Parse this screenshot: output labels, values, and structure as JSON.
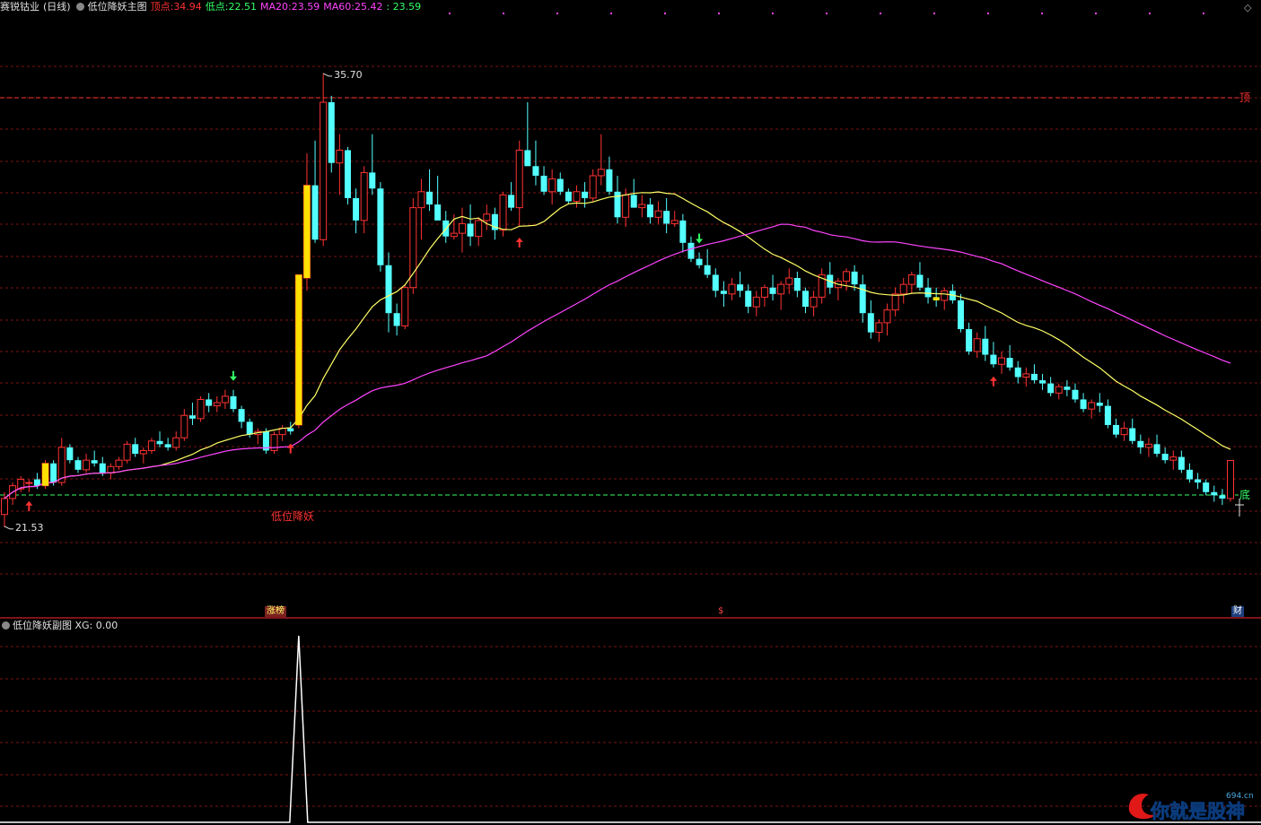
{
  "header": {
    "stock_name": "赛锐钴业",
    "period": "(日线)",
    "indicator_name": "低位降妖主图",
    "top_label": "顶点:",
    "top_value": "34.94",
    "low_label": "低点:",
    "low_value": "22.51",
    "ma20_label": "MA20:",
    "ma20_value": "23.59",
    "ma60_label": "MA60:",
    "ma60_value": "25.42",
    "last_value": ": 23.59"
  },
  "annotations": {
    "high_label": "35.70",
    "low_label": "21.53",
    "top_line_label": "顶",
    "bottom_line_label": "底",
    "signal_text": "低位降妖",
    "event_zhangting": "涨榜",
    "event_dollar": "$",
    "event_cai": "财"
  },
  "sub_header": {
    "indicator_name": "低位降妖副图",
    "xg_label": "XG:",
    "xg_value": "0.00"
  },
  "watermark": {
    "text": "你就是股神",
    "domain": "694.cn"
  },
  "colors": {
    "up": "#ff3232",
    "down": "#54ffff",
    "ma20": "#ffff66",
    "ma60": "#ff44ff",
    "grid": "#7a1414",
    "signal_bar": "#ffe000"
  },
  "chart_data": {
    "type": "candlestick",
    "top_price": 34.94,
    "bottom_price": 22.51,
    "high_mark": 35.7,
    "low_mark": 21.53,
    "candles": [
      [
        21.9,
        22.6,
        21.5,
        22.4
      ],
      [
        22.4,
        22.9,
        22.2,
        22.8
      ],
      [
        22.7,
        23.1,
        22.6,
        23.0
      ],
      [
        22.9,
        23.0,
        22.6,
        22.9
      ],
      [
        23.0,
        23.2,
        22.7,
        22.8
      ],
      [
        22.8,
        23.6,
        22.7,
        23.5
      ],
      [
        23.5,
        23.6,
        22.8,
        22.9
      ],
      [
        22.9,
        24.3,
        22.8,
        24.0
      ],
      [
        24.0,
        24.1,
        23.5,
        23.6
      ],
      [
        23.6,
        23.7,
        23.2,
        23.3
      ],
      [
        23.3,
        23.8,
        23.2,
        23.6
      ],
      [
        23.6,
        23.9,
        23.4,
        23.5
      ],
      [
        23.5,
        23.7,
        23.1,
        23.2
      ],
      [
        23.2,
        23.5,
        23.0,
        23.4
      ],
      [
        23.4,
        23.7,
        23.3,
        23.6
      ],
      [
        23.6,
        24.2,
        23.5,
        24.1
      ],
      [
        24.1,
        24.3,
        23.7,
        23.8
      ],
      [
        23.8,
        24.0,
        23.5,
        23.9
      ],
      [
        23.9,
        24.3,
        23.8,
        24.2
      ],
      [
        24.2,
        24.5,
        24.0,
        24.1
      ],
      [
        24.1,
        24.3,
        23.9,
        24.0
      ],
      [
        24.0,
        24.5,
        23.9,
        24.3
      ],
      [
        24.3,
        25.2,
        24.2,
        25.0
      ],
      [
        25.0,
        25.4,
        24.7,
        24.9
      ],
      [
        24.9,
        25.6,
        24.8,
        25.5
      ],
      [
        25.5,
        25.7,
        25.1,
        25.3
      ],
      [
        25.3,
        25.6,
        25.1,
        25.4
      ],
      [
        25.4,
        25.8,
        25.2,
        25.6
      ],
      [
        25.6,
        25.8,
        25.1,
        25.2
      ],
      [
        25.2,
        25.3,
        24.6,
        24.8
      ],
      [
        24.8,
        24.9,
        24.3,
        24.4
      ],
      [
        24.4,
        24.6,
        24.1,
        24.5
      ],
      [
        24.5,
        24.6,
        23.8,
        23.9
      ],
      [
        23.9,
        24.5,
        23.8,
        24.4
      ],
      [
        24.4,
        24.7,
        24.2,
        24.6
      ],
      [
        24.6,
        24.8,
        24.4,
        24.5
      ],
      [
        24.7,
        29.4,
        24.6,
        29.4
      ],
      [
        29.3,
        33.2,
        28.9,
        32.2
      ],
      [
        32.2,
        33.6,
        30.4,
        30.5
      ],
      [
        30.5,
        35.7,
        30.3,
        34.8
      ],
      [
        34.8,
        35.0,
        32.6,
        32.9
      ],
      [
        32.9,
        33.8,
        31.9,
        33.3
      ],
      [
        33.3,
        33.4,
        31.6,
        31.8
      ],
      [
        31.8,
        32.1,
        30.7,
        31.1
      ],
      [
        31.1,
        32.8,
        30.7,
        32.6
      ],
      [
        32.6,
        33.8,
        31.9,
        32.1
      ],
      [
        32.1,
        32.3,
        29.5,
        29.7
      ],
      [
        29.7,
        30.1,
        27.6,
        28.2
      ],
      [
        28.2,
        28.5,
        27.5,
        27.8
      ],
      [
        27.8,
        29.1,
        27.7,
        29.0
      ],
      [
        29.0,
        31.8,
        28.8,
        31.5
      ],
      [
        31.5,
        32.4,
        30.5,
        32.0
      ],
      [
        32.0,
        32.7,
        31.4,
        31.6
      ],
      [
        31.6,
        32.5,
        31.5,
        31.1
      ],
      [
        31.1,
        31.4,
        30.4,
        30.6
      ],
      [
        30.6,
        31.3,
        30.5,
        30.7
      ],
      [
        30.7,
        31.5,
        30.1,
        31.0
      ],
      [
        31.0,
        31.6,
        30.3,
        30.6
      ],
      [
        30.6,
        31.2,
        30.3,
        31.1
      ],
      [
        31.1,
        31.6,
        30.8,
        31.3
      ],
      [
        31.3,
        31.5,
        30.5,
        30.8
      ],
      [
        30.8,
        32.0,
        30.6,
        31.9
      ],
      [
        31.9,
        32.3,
        31.4,
        31.5
      ],
      [
        31.5,
        33.6,
        30.9,
        33.3
      ],
      [
        33.3,
        34.8,
        32.8,
        32.8
      ],
      [
        32.8,
        33.6,
        32.2,
        32.5
      ],
      [
        32.5,
        32.8,
        31.9,
        32.0
      ],
      [
        32.0,
        32.7,
        31.6,
        32.4
      ],
      [
        32.4,
        32.6,
        31.9,
        32.0
      ],
      [
        32.0,
        32.1,
        31.6,
        31.7
      ],
      [
        31.7,
        32.2,
        31.5,
        32.0
      ],
      [
        32.0,
        32.3,
        31.5,
        31.8
      ],
      [
        31.8,
        32.7,
        31.7,
        32.5
      ],
      [
        32.5,
        33.8,
        32.2,
        32.7
      ],
      [
        32.7,
        33.1,
        31.9,
        32.0
      ],
      [
        32.0,
        32.5,
        31.0,
        31.2
      ],
      [
        31.2,
        32.1,
        30.9,
        31.9
      ],
      [
        31.9,
        32.4,
        31.7,
        31.5
      ],
      [
        31.5,
        31.9,
        31.2,
        31.6
      ],
      [
        31.6,
        31.8,
        31.0,
        31.2
      ],
      [
        31.2,
        31.7,
        31.0,
        31.4
      ],
      [
        31.4,
        31.8,
        30.7,
        31.0
      ],
      [
        31.0,
        31.4,
        30.9,
        31.1
      ],
      [
        31.1,
        31.3,
        30.1,
        30.4
      ],
      [
        30.4,
        30.6,
        29.8,
        29.9
      ],
      [
        29.9,
        30.1,
        29.6,
        29.7
      ],
      [
        29.7,
        30.2,
        29.3,
        29.4
      ],
      [
        29.4,
        29.6,
        28.7,
        28.9
      ],
      [
        28.9,
        29.2,
        28.4,
        28.8
      ],
      [
        28.8,
        29.3,
        28.6,
        29.1
      ],
      [
        29.1,
        29.5,
        28.7,
        28.9
      ],
      [
        28.9,
        29.1,
        28.2,
        28.4
      ],
      [
        28.4,
        28.9,
        28.1,
        28.7
      ],
      [
        28.7,
        29.1,
        28.4,
        29.0
      ],
      [
        29.0,
        29.4,
        28.6,
        28.8
      ],
      [
        28.8,
        29.2,
        28.3,
        29.1
      ],
      [
        29.1,
        29.6,
        28.8,
        29.3
      ],
      [
        29.3,
        29.5,
        28.7,
        28.9
      ],
      [
        28.9,
        29.0,
        28.2,
        28.4
      ],
      [
        28.4,
        28.9,
        28.1,
        28.7
      ],
      [
        28.7,
        29.6,
        28.5,
        29.4
      ],
      [
        29.4,
        29.8,
        28.8,
        29.0
      ],
      [
        29.0,
        29.3,
        28.6,
        29.2
      ],
      [
        29.2,
        29.6,
        28.9,
        29.5
      ],
      [
        29.5,
        29.7,
        28.9,
        29.1
      ],
      [
        29.1,
        29.4,
        27.9,
        28.2
      ],
      [
        28.2,
        28.6,
        27.4,
        27.6
      ],
      [
        27.6,
        28.0,
        27.3,
        27.9
      ],
      [
        27.9,
        28.5,
        27.5,
        28.3
      ],
      [
        28.3,
        29.0,
        28.1,
        28.8
      ],
      [
        28.8,
        29.3,
        28.5,
        29.1
      ],
      [
        29.1,
        29.5,
        28.8,
        29.4
      ],
      [
        29.4,
        29.8,
        28.9,
        29.0
      ],
      [
        29.0,
        29.3,
        28.5,
        28.7
      ],
      [
        28.7,
        29.0,
        28.4,
        28.6
      ],
      [
        28.6,
        29.0,
        28.3,
        28.9
      ],
      [
        28.9,
        29.1,
        28.5,
        28.6
      ],
      [
        28.6,
        28.8,
        27.6,
        27.7
      ],
      [
        27.7,
        27.9,
        26.9,
        27.0
      ],
      [
        27.0,
        27.6,
        26.8,
        27.4
      ],
      [
        27.4,
        27.8,
        26.7,
        26.9
      ],
      [
        26.9,
        27.3,
        26.5,
        26.6
      ],
      [
        26.6,
        27.0,
        26.3,
        26.8
      ],
      [
        26.8,
        27.2,
        26.4,
        26.5
      ],
      [
        26.5,
        26.7,
        26.0,
        26.2
      ],
      [
        26.2,
        26.5,
        25.9,
        26.3
      ],
      [
        26.3,
        26.6,
        26.0,
        26.1
      ],
      [
        26.1,
        26.3,
        25.8,
        26.0
      ],
      [
        26.0,
        26.2,
        25.6,
        25.7
      ],
      [
        25.7,
        26.0,
        25.5,
        25.9
      ],
      [
        25.9,
        26.1,
        25.6,
        25.8
      ],
      [
        25.8,
        26.0,
        25.4,
        25.5
      ],
      [
        25.5,
        25.7,
        25.1,
        25.2
      ],
      [
        25.2,
        25.5,
        24.9,
        25.4
      ],
      [
        25.4,
        25.7,
        25.1,
        25.3
      ],
      [
        25.3,
        25.5,
        24.6,
        24.7
      ],
      [
        24.7,
        24.9,
        24.3,
        24.4
      ],
      [
        24.4,
        24.8,
        24.2,
        24.6
      ],
      [
        24.6,
        24.9,
        24.1,
        24.2
      ],
      [
        24.2,
        24.4,
        23.8,
        24.0
      ],
      [
        24.0,
        24.3,
        23.7,
        24.1
      ],
      [
        24.1,
        24.4,
        23.7,
        23.8
      ],
      [
        23.8,
        24.0,
        23.5,
        23.6
      ],
      [
        23.6,
        23.9,
        23.3,
        23.7
      ],
      [
        23.7,
        23.9,
        23.2,
        23.3
      ],
      [
        23.3,
        23.5,
        22.9,
        23.0
      ],
      [
        23.0,
        23.2,
        22.7,
        22.9
      ],
      [
        22.9,
        23.0,
        22.5,
        22.6
      ],
      [
        22.6,
        22.8,
        22.3,
        22.5
      ],
      [
        22.5,
        22.7,
        22.2,
        22.4
      ],
      [
        22.4,
        23.6,
        22.3,
        23.59
      ]
    ]
  }
}
